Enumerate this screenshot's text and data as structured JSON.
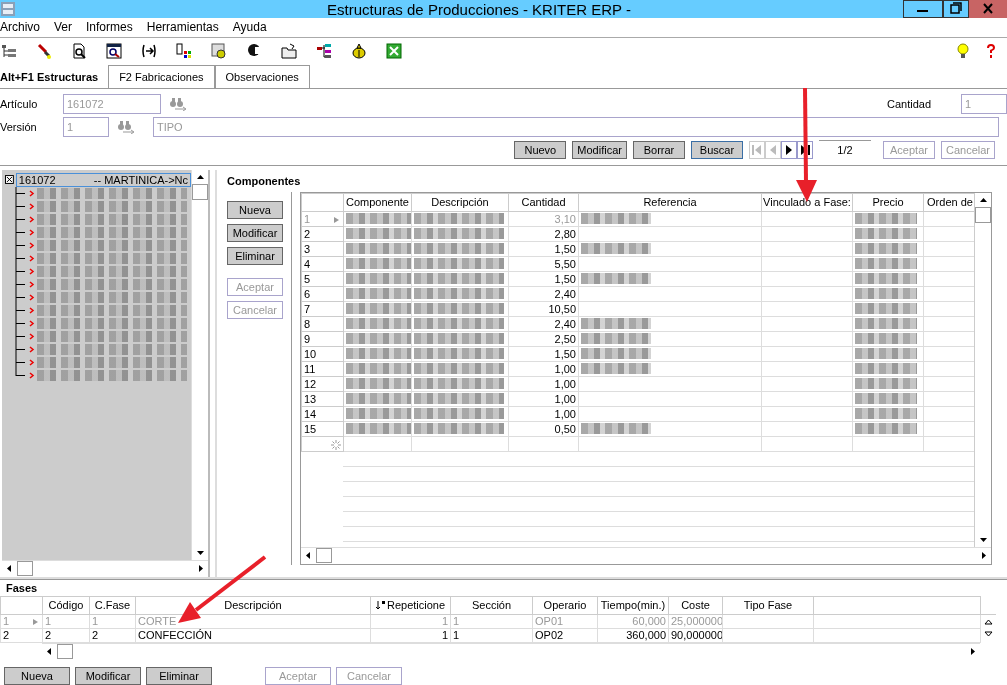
{
  "window": {
    "title": "Estructuras de Producciones - KRITER ERP -"
  },
  "menu": [
    "Archivo",
    "Ver",
    "Informes",
    "Herramientas",
    "Ayuda"
  ],
  "tabs": [
    {
      "label": "Alt+F1 Estructuras",
      "selected": true
    },
    {
      "label": "F2 Fabricaciones",
      "selected": false
    },
    {
      "label": "Observaciones",
      "selected": false
    }
  ],
  "form": {
    "articulo": {
      "label": "Artículo",
      "value": "161072",
      "disabled": true
    },
    "version": {
      "label": "Versión",
      "value": "1",
      "disabled": true
    },
    "tipo": {
      "value": "TIPO",
      "disabled": true
    },
    "cantidad": {
      "label": "Cantidad",
      "value": "1",
      "disabled": true
    }
  },
  "record_buttons": [
    {
      "label": "Nuevo",
      "disabled": false,
      "focused": false
    },
    {
      "label": "Modificar",
      "disabled": false,
      "focused": false
    },
    {
      "label": "Borrar",
      "disabled": false,
      "focused": false
    },
    {
      "label": "Buscar",
      "disabled": false,
      "focused": true
    }
  ],
  "navigator": {
    "buttons": [
      {
        "kind": "first",
        "disabled": true
      },
      {
        "kind": "prev",
        "disabled": true
      },
      {
        "kind": "next",
        "disabled": false
      },
      {
        "kind": "last",
        "disabled": false
      }
    ],
    "position": "1/2"
  },
  "confirm_buttons": [
    {
      "label": "Aceptar",
      "disabled": true
    },
    {
      "label": "Cancelar",
      "disabled": true
    }
  ],
  "tree": {
    "root": {
      "code": "161072",
      "label": "-- MARTINICA->Nc",
      "expanded": true,
      "selected": true,
      "children": [
        {
          "kind": "redacted"
        },
        {
          "kind": "redacted"
        },
        {
          "kind": "redacted"
        },
        {
          "kind": "redacted"
        },
        {
          "kind": "redacted"
        },
        {
          "kind": "redacted"
        },
        {
          "kind": "redacted"
        },
        {
          "kind": "redacted"
        },
        {
          "kind": "redacted"
        },
        {
          "kind": "redacted"
        },
        {
          "kind": "redacted"
        },
        {
          "kind": "redacted"
        },
        {
          "kind": "redacted"
        },
        {
          "kind": "redacted"
        },
        {
          "kind": "redacted"
        }
      ]
    }
  },
  "components": {
    "title": "Componentes",
    "buttons": [
      {
        "label": "Nueva",
        "disabled": false
      },
      {
        "label": "Modificar",
        "disabled": false
      },
      {
        "label": "Eliminar",
        "disabled": false
      },
      {
        "label": "Aceptar",
        "disabled": true
      },
      {
        "label": "Cancelar",
        "disabled": true
      }
    ],
    "columns": [
      {
        "label": "Componente",
        "kind": "redacted"
      },
      {
        "label": "Descripción",
        "kind": "redacted"
      },
      {
        "label": "Cantidad",
        "kind": "number"
      },
      {
        "label": "Referencia",
        "kind": "reference"
      },
      {
        "label": "Vinculado a Fase:",
        "kind": "empty"
      },
      {
        "label": "Precio",
        "kind": "redacted"
      },
      {
        "label": "Orden de",
        "kind": "empty"
      }
    ],
    "rows": [
      {
        "number": "1",
        "current": true,
        "cells": [
          "3,10"
        ],
        "reference_redacted": true
      },
      {
        "number": "2",
        "current": false,
        "cells": [
          "2,80"
        ],
        "reference_redacted": false
      },
      {
        "number": "3",
        "current": false,
        "cells": [
          "1,50"
        ],
        "reference_redacted": true
      },
      {
        "number": "4",
        "current": false,
        "cells": [
          "5,50"
        ],
        "reference_redacted": false
      },
      {
        "number": "5",
        "current": false,
        "cells": [
          "1,50"
        ],
        "reference_redacted": true
      },
      {
        "number": "6",
        "current": false,
        "cells": [
          "2,40"
        ],
        "reference_redacted": false
      },
      {
        "number": "7",
        "current": false,
        "cells": [
          "10,50"
        ],
        "reference_redacted": false
      },
      {
        "number": "8",
        "current": false,
        "cells": [
          "2,40"
        ],
        "reference_redacted": true
      },
      {
        "number": "9",
        "current": false,
        "cells": [
          "2,50"
        ],
        "reference_redacted": true
      },
      {
        "number": "10",
        "current": false,
        "cells": [
          "1,50"
        ],
        "reference_redacted": true
      },
      {
        "number": "11",
        "current": false,
        "cells": [
          "1,00"
        ],
        "reference_redacted": true
      },
      {
        "number": "12",
        "current": false,
        "cells": [
          "1,00"
        ],
        "reference_redacted": false
      },
      {
        "number": "13",
        "current": false,
        "cells": [
          "1,00"
        ],
        "reference_redacted": false
      },
      {
        "number": "14",
        "current": false,
        "cells": [
          "1,00"
        ],
        "reference_redacted": false
      },
      {
        "number": "15",
        "current": false,
        "cells": [
          "0,50"
        ],
        "reference_redacted": true
      }
    ]
  },
  "phases": {
    "title": "Fases",
    "columns": [
      {
        "label": "Código",
        "kind": "text",
        "sorted": false
      },
      {
        "label": "C.Fase",
        "kind": "text",
        "sorted": false
      },
      {
        "label": "Descripción",
        "kind": "text",
        "sorted": false
      },
      {
        "label": "Repeticione",
        "kind": "number",
        "sorted": true
      },
      {
        "label": "Sección",
        "kind": "text",
        "sorted": false
      },
      {
        "label": "Operario",
        "kind": "text",
        "sorted": false
      },
      {
        "label": "Tiempo(min.)",
        "kind": "number",
        "sorted": false
      },
      {
        "label": "Coste",
        "kind": "text",
        "sorted": false
      },
      {
        "label": "Tipo Fase",
        "kind": "empty",
        "sorted": false
      }
    ],
    "rows": [
      {
        "number": "1",
        "current": true,
        "cells": [
          "1",
          "1",
          "CORTE",
          "1",
          "1",
          "OP01",
          "60,000",
          "25,000000"
        ]
      },
      {
        "number": "2",
        "current": false,
        "cells": [
          "2",
          "2",
          "CONFECCIÓN",
          "1",
          "1",
          "OP02",
          "360,000",
          "90,000000"
        ]
      }
    ],
    "buttons": [
      {
        "label": "Nueva",
        "disabled": false
      },
      {
        "label": "Modificar",
        "disabled": false
      },
      {
        "label": "Eliminar",
        "disabled": false
      },
      {
        "label": "Aceptar",
        "disabled": true
      },
      {
        "label": "Cancelar",
        "disabled": true
      }
    ]
  }
}
